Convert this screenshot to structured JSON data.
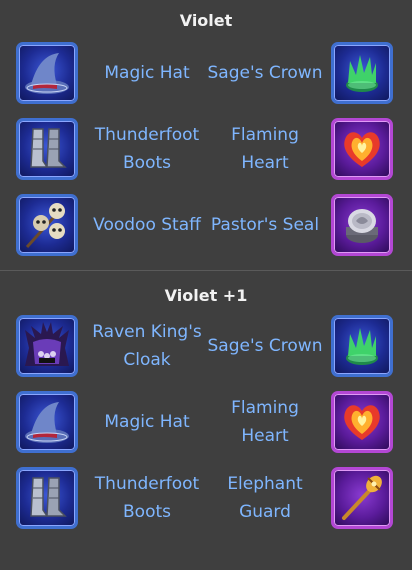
{
  "sections": [
    {
      "title": "Violet",
      "rows": [
        {
          "left": {
            "name": "Magic Hat",
            "icon": "magic-hat-icon",
            "tier": "blue"
          },
          "right": {
            "name": "Sage's Crown",
            "icon": "sages-crown-icon",
            "tier": "blue"
          }
        },
        {
          "left": {
            "name": "Thunderfoot Boots",
            "icon": "thunderfoot-boots-icon",
            "tier": "blue"
          },
          "right": {
            "name": "Flaming Heart",
            "icon": "flaming-heart-icon",
            "tier": "purple"
          }
        },
        {
          "left": {
            "name": "Voodoo Staff",
            "icon": "voodoo-staff-icon",
            "tier": "blue"
          },
          "right": {
            "name": "Pastor's Seal",
            "icon": "pastors-seal-icon",
            "tier": "purple"
          }
        }
      ]
    },
    {
      "title": "Violet +1",
      "rows": [
        {
          "left": {
            "name": "Raven King's Cloak",
            "icon": "raven-kings-cloak-icon",
            "tier": "blue"
          },
          "right": {
            "name": "Sage's Crown",
            "icon": "sages-crown-icon",
            "tier": "blue"
          }
        },
        {
          "left": {
            "name": "Magic Hat",
            "icon": "magic-hat-icon",
            "tier": "blue"
          },
          "right": {
            "name": "Flaming Heart",
            "icon": "flaming-heart-icon",
            "tier": "purple"
          }
        },
        {
          "left": {
            "name": "Thunderfoot Boots",
            "icon": "thunderfoot-boots-icon",
            "tier": "blue"
          },
          "right": {
            "name": "Elephant Guard",
            "icon": "elephant-guard-icon",
            "tier": "purple"
          }
        }
      ]
    }
  ],
  "colors": {
    "background": "#3f3f3f",
    "title": "#f2f2f2",
    "item_label": "#7fb6ff",
    "blue_tier_border": "#3f6fd0",
    "purple_tier_border": "#b347d4"
  }
}
